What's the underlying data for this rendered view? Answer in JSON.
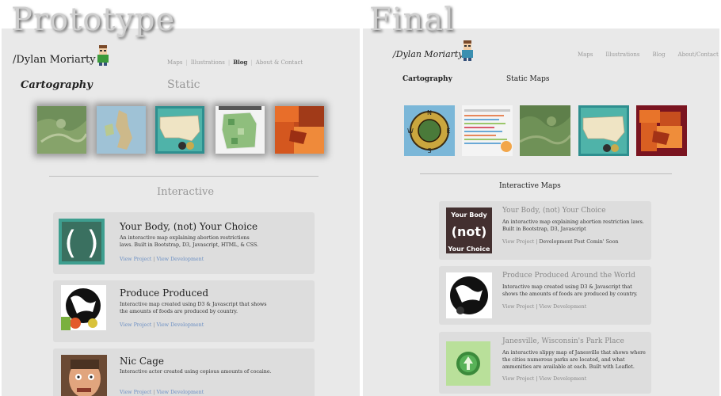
{
  "labels": {
    "prototype": "Prototype",
    "final": "Final"
  },
  "prototype": {
    "brand_slash": "/",
    "brand": "Dylan Moriarty",
    "nav": [
      "Maps",
      "Illustrations",
      "Blog",
      "About & Contact"
    ],
    "nav_active": "Blog",
    "section_cartography": "Cartography",
    "section_static": "Static",
    "section_interactive": "Interactive",
    "cards": [
      {
        "title": "Your Body, (not) Your Choice",
        "desc": "An interactive map explaining abortion restrictions laws. Built in Bootstrap, D3, Javascript, HTML, & CSS.",
        "link1": "View Project",
        "sep": "|",
        "link2": "View Development"
      },
      {
        "title": "Produce Produced",
        "desc": "Interactive map created using D3 & Javascript that shows the amounts of foods are produced by country.",
        "link1": "View Project",
        "sep": "|",
        "link2": "View Development"
      },
      {
        "title": "Nic Cage",
        "desc": "Interactive actor created using copious amounts of cocaine.",
        "link1": "View Project",
        "sep": "|",
        "link2": "View Development"
      }
    ]
  },
  "final": {
    "brand_slash": "/",
    "brand": "Dylan Moriarty",
    "nav": [
      "Maps",
      "Illustrations",
      "Blog",
      "About/Contact"
    ],
    "section_cartography": "Cartography",
    "section_static": "Static Maps",
    "section_interactive": "Interactive Maps",
    "cards": [
      {
        "title": "Your Body, (not) Your Choice",
        "desc": "An interactive map explaining abortion restriction laws. Built in Bootstrap, D3, Javascript",
        "link1": "View Project",
        "sep": "|",
        "link2": "Development Post Comin' Soon",
        "img_top": "Your Body",
        "img_mid": "(not)",
        "img_bot": "Your Choice"
      },
      {
        "title": "Produce Produced Around the World",
        "desc": "Interactive map created using D3 & Javascript that shows the amounts of foods are produced by country.",
        "link1": "View Project",
        "sep": "|",
        "link2": "View Development"
      },
      {
        "title": "Janesville, Wisconsin's Park Place",
        "desc": "An interactive slippy map of Janesville that shows where the cities numerous parks are located, and what ammenities are available at each. Built with Leaflet.",
        "link1": "View Project",
        "sep": "|",
        "link2": "View Development"
      }
    ]
  },
  "thumb_icons": {
    "proto": [
      "terrain-map-icon",
      "british-isles-map-icon",
      "usa-map-icon",
      "wisconsin-map-icon",
      "choropleth-map-icon"
    ],
    "final": [
      "compass-rose-icon",
      "infographic-chart-icon",
      "terrain-map-icon",
      "usa-map-icon",
      "choropleth-map-icon"
    ]
  },
  "thumb_text": {
    "compass_n": "N",
    "compass_e": "E",
    "compass_s": "S",
    "compass_w": "W"
  },
  "colors": {
    "panel_bg": "#e9e9e9",
    "card_bg": "#dddddd",
    "link": "#6b8fc4",
    "label_shadow": "#6a6a6a"
  }
}
